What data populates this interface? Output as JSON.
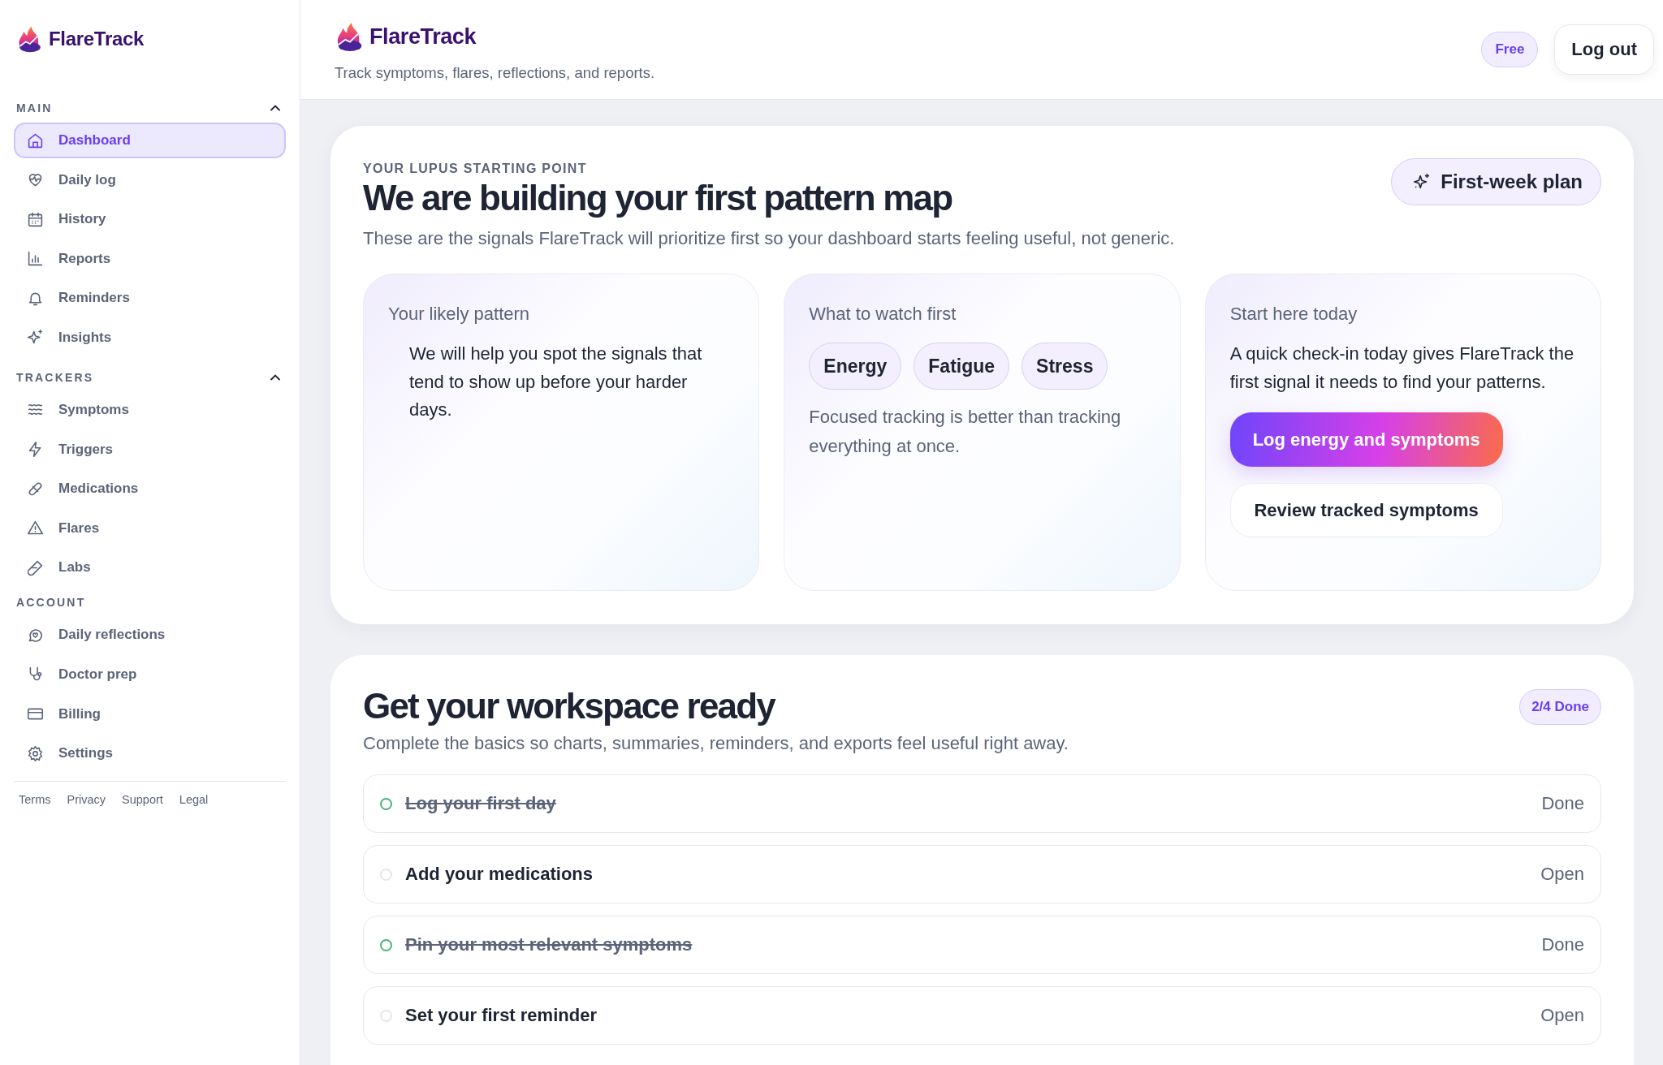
{
  "sidebar": {
    "brand": "FlareTrack",
    "sections": [
      {
        "title": "MAIN",
        "expanded": true,
        "items": [
          {
            "label": "Dashboard",
            "selected": true
          },
          {
            "label": "Daily log",
            "selected": false
          },
          {
            "label": "History",
            "selected": false
          },
          {
            "label": "Reports",
            "selected": false
          },
          {
            "label": "Reminders",
            "selected": false
          },
          {
            "label": "Insights",
            "selected": false
          }
        ]
      },
      {
        "title": "TRACKERS",
        "expanded": true,
        "items": [
          {
            "label": "Symptoms",
            "selected": false
          },
          {
            "label": "Triggers",
            "selected": false
          },
          {
            "label": "Medications",
            "selected": false
          },
          {
            "label": "Flares",
            "selected": false
          },
          {
            "label": "Labs",
            "selected": false
          }
        ]
      },
      {
        "title": "ACCOUNT",
        "items": [
          {
            "label": "Daily reflections",
            "selected": false
          },
          {
            "label": "Doctor prep",
            "selected": false
          },
          {
            "label": "Billing",
            "selected": false
          },
          {
            "label": "Settings",
            "selected": false
          }
        ]
      }
    ],
    "footer_links": [
      "Terms",
      "Privacy",
      "Support",
      "Legal"
    ]
  },
  "header": {
    "brand": "FlareTrack",
    "tagline": "Track symptoms, flares, reflections, and reports.",
    "plan_badge": "Free",
    "logout": "Log out"
  },
  "hero": {
    "eyebrow": "YOUR LUPUS STARTING POINT",
    "title": "We are building your first pattern map",
    "subtitle": "These are the signals FlareTrack will prioritize first so your dashboard starts feeling useful, not generic.",
    "action": "First-week plan",
    "cards": [
      {
        "kind": "text",
        "title": "Your likely pattern",
        "body": "We will help you spot the signals that tend to show up before your harder days."
      },
      {
        "kind": "chips",
        "title": "What to watch first",
        "chips": [
          "Energy",
          "Fatigue",
          "Stress"
        ],
        "note": "Focused tracking is better than tracking everything at once."
      },
      {
        "kind": "actions",
        "title": "Start here today",
        "body": "A quick check-in today gives FlareTrack the first signal it needs to find your patterns.",
        "primary": "Log energy and symptoms",
        "secondary": "Review tracked symptoms"
      }
    ]
  },
  "checklist": {
    "title": "Get your workspace ready",
    "subtitle": "Complete the basics so charts, summaries, reminders, and exports feel useful right away.",
    "progress": "2/4 Done",
    "items": [
      {
        "label": "Log your first day",
        "done": true,
        "status": "Done"
      },
      {
        "label": "Add your medications",
        "done": false,
        "status": "Open"
      },
      {
        "label": "Pin your most relevant symptoms",
        "done": true,
        "status": "Done"
      },
      {
        "label": "Set your first reminder",
        "done": false,
        "status": "Open"
      }
    ]
  }
}
